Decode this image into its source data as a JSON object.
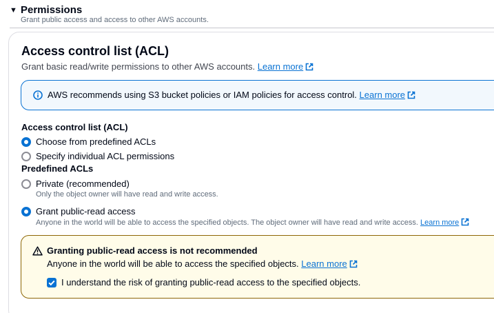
{
  "permissions": {
    "caret": "▼",
    "title": "Permissions",
    "description": "Grant public access and access to other AWS accounts."
  },
  "acl": {
    "title": "Access control list (ACL)",
    "description": "Grant basic read/write permissions to other AWS accounts.",
    "learn_more": "Learn more"
  },
  "info": {
    "text": "AWS recommends using S3 bucket policies or IAM policies for access control.",
    "learn_more": "Learn more",
    "icon": "info-icon"
  },
  "acl_mode": {
    "label": "Access control list (ACL)",
    "options": [
      {
        "label": "Choose from predefined ACLs",
        "checked": true
      },
      {
        "label": "Specify individual ACL permissions",
        "checked": false
      }
    ]
  },
  "predefined": {
    "label": "Predefined ACLs",
    "options": [
      {
        "label": "Private (recommended)",
        "description": "Only the object owner will have read and write access.",
        "checked": false
      },
      {
        "label": "Grant public-read access",
        "description": "Anyone in the world will be able to access the specified objects. The object owner will have read and write access.",
        "learn_more": "Learn more",
        "checked": true
      }
    ]
  },
  "warning": {
    "title": "Granting public-read access is not recommended",
    "text": "Anyone in the world will be able to access the specified objects.",
    "learn_more": "Learn more",
    "checkbox_label": "I understand the risk of granting public-read access to the specified objects.",
    "checkbox_checked": true,
    "icon": "warning-icon"
  },
  "colors": {
    "link": "#0972d3",
    "info_bg": "#f2f8fd",
    "warning_bg": "#fffce9",
    "warning_border": "#8d6605"
  }
}
